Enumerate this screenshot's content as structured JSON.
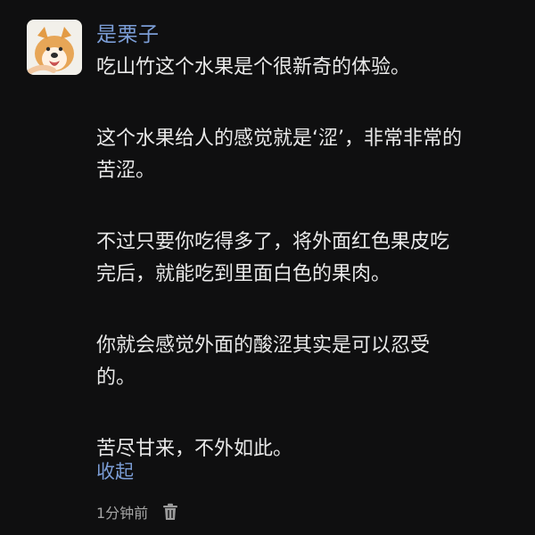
{
  "comment": {
    "username": "是栗子",
    "paragraphs": [
      "吃山竹这个水果是个很新奇的体验。",
      "这个水果给人的感觉就是‘涩’，非常非常的\n苦涩。",
      "不过只要你吃得多了，将外面红色果皮吃\n完后，就能吃到里面白色的果肉。",
      "你就会感觉外面的酸涩其实是可以忍受\n的。",
      "苦尽甘来，不外如此。"
    ],
    "collapse_label": "收起",
    "timestamp": "1分钟前",
    "icons": {
      "avatar": "shiba-dog-avatar",
      "delete": "trash-icon"
    },
    "colors": {
      "background": "#0f0f10",
      "username": "#7b9dd6",
      "text": "#e9e9e9",
      "link": "#7b9dd6",
      "meta": "#a5a5a5"
    }
  }
}
